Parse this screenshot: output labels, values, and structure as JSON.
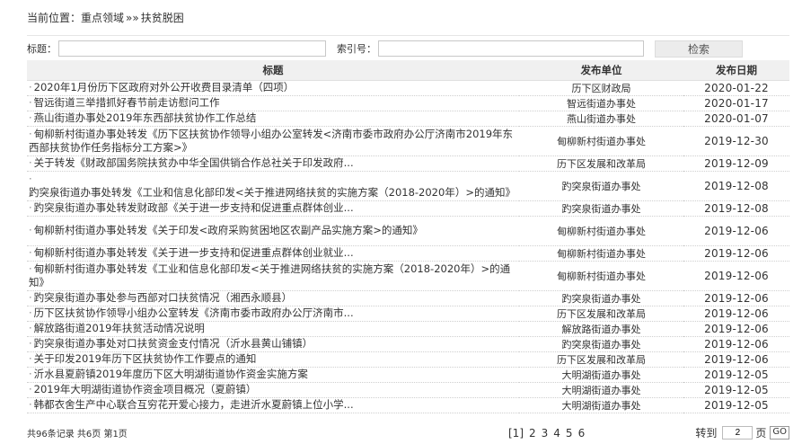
{
  "breadcrumb": {
    "prefix": "当前位置：",
    "home": "重点领域",
    "sep": "»»",
    "current": "扶贫脱困"
  },
  "search": {
    "title_label": "标题：",
    "title_value": "",
    "index_label": "索引号：",
    "index_value": "",
    "button": "检索"
  },
  "table": {
    "headers": [
      "标题",
      "发布单位",
      "发布日期"
    ],
    "rows": [
      {
        "title": "2020年1月份历下区政府对外公开收费目录清单（四项）",
        "unit": "历下区财政局",
        "date": "2020-01-22",
        "two": false
      },
      {
        "title": "智远街道三举措抓好春节前走访慰问工作",
        "unit": "智远街道办事处",
        "date": "2020-01-17",
        "two": false
      },
      {
        "title": "燕山街道办事处2019年东西部扶贫协作工作总结",
        "unit": "燕山街道办事处",
        "date": "2020-01-07",
        "two": false
      },
      {
        "title": "甸柳新村街道办事处转发《历下区扶贫协作领导小组办公室转发<济南市委市政府办公厅济南市2019年东西部扶贫协作任务指标分工方案>》",
        "unit": "甸柳新村街道办事处",
        "date": "2019-12-30",
        "two": true
      },
      {
        "title": "关于转发《财政部国务院扶贫办中华全国供销合作总社关于印发政府...",
        "unit": "历下区发展和改革局",
        "date": "2019-12-09",
        "two": false
      },
      {
        "title": "趵突泉街道办事处转发《工业和信息化部印发<关于推进网络扶贫的实施方案（2018-2020年）>的通知》",
        "unit": "趵突泉街道办事处",
        "date": "2019-12-08",
        "two": true
      },
      {
        "title": "趵突泉街道办事处转发财政部《关于进一步支持和促进重点群体创业...",
        "unit": "趵突泉街道办事处",
        "date": "2019-12-08",
        "two": false
      },
      {
        "title": "甸柳新村街道办事处转发《关于印发<政府采购贫困地区农副产品实施方案>的通知》",
        "unit": "甸柳新村街道办事处",
        "date": "2019-12-06",
        "two": true
      },
      {
        "title": "甸柳新村街道办事处转发《关于进一步支持和促进重点群体创业就业...",
        "unit": "甸柳新村街道办事处",
        "date": "2019-12-06",
        "two": false
      },
      {
        "title": "甸柳新村街道办事处转发《工业和信息化部印发<关于推进网络扶贫的实施方案（2018-2020年）>的通知》",
        "unit": "甸柳新村街道办事处",
        "date": "2019-12-06",
        "two": true
      },
      {
        "title": "趵突泉街道办事处参与西部对口扶贫情况（湘西永顺县）",
        "unit": "趵突泉街道办事处",
        "date": "2019-12-06",
        "two": false
      },
      {
        "title": "历下区扶贫协作领导小组办公室转发《济南市委市政府办公厅济南市...",
        "unit": "历下区发展和改革局",
        "date": "2019-12-06",
        "two": false
      },
      {
        "title": "解放路街道2019年扶贫活动情况说明",
        "unit": "解放路街道办事处",
        "date": "2019-12-06",
        "two": false
      },
      {
        "title": "趵突泉街道办事处对口扶贫资金支付情况（沂水县黄山铺镇）",
        "unit": "趵突泉街道办事处",
        "date": "2019-12-06",
        "two": false
      },
      {
        "title": "关于印发2019年历下区扶贫协作工作要点的通知",
        "unit": "历下区发展和改革局",
        "date": "2019-12-06",
        "two": false
      },
      {
        "title": "沂水县夏蔚镇2019年度历下区大明湖街道协作资金实施方案",
        "unit": "大明湖街道办事处",
        "date": "2019-12-05",
        "two": false
      },
      {
        "title": "2019年大明湖街道协作资金项目概况（夏蔚镇）",
        "unit": "大明湖街道办事处",
        "date": "2019-12-05",
        "two": false
      },
      {
        "title": "韩都衣舍生产中心联合互穷花开爱心接力，走进沂水夏蔚镇上位小学...",
        "unit": "大明湖街道办事处",
        "date": "2019-12-05",
        "two": false
      }
    ]
  },
  "footer": {
    "info": "共96条记录  共6页  第1页",
    "pages": [
      "[1]",
      "2",
      "3",
      "4",
      "5",
      "6"
    ],
    "goto_label": "转到",
    "goto_value": "2",
    "page_suffix": "页",
    "go_label": "GO"
  }
}
